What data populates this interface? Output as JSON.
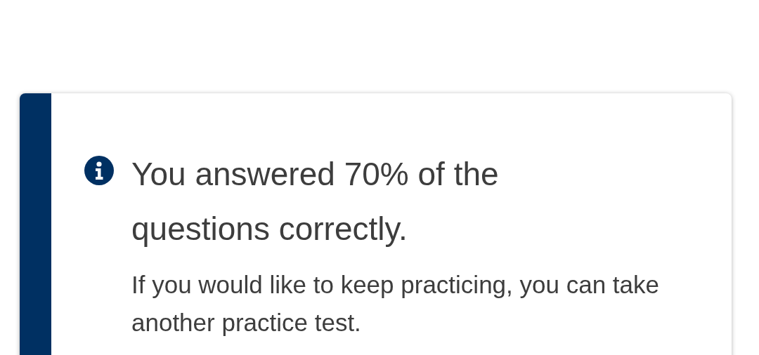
{
  "alert": {
    "kind": "info",
    "title": "You answered 70% of the questions correctly.",
    "message": "If you would like to keep practicing, you can take another practice test."
  }
}
